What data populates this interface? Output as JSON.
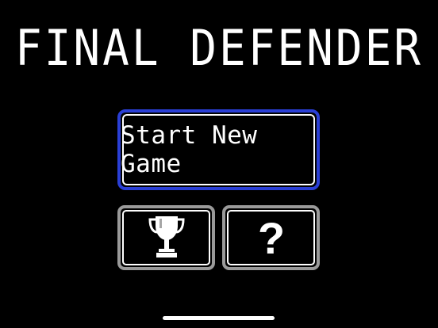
{
  "game": {
    "title": "FINAL DEFENDER"
  },
  "menu": {
    "start_label": "Start New Game",
    "leaderboard_icon": "trophy-icon",
    "help_icon": "question-mark-icon",
    "help_glyph": "?"
  },
  "colors": {
    "background": "#000000",
    "start_border": "#2a3fd6",
    "icon_button_border": "#9a9a9a",
    "text": "#ffffff"
  }
}
